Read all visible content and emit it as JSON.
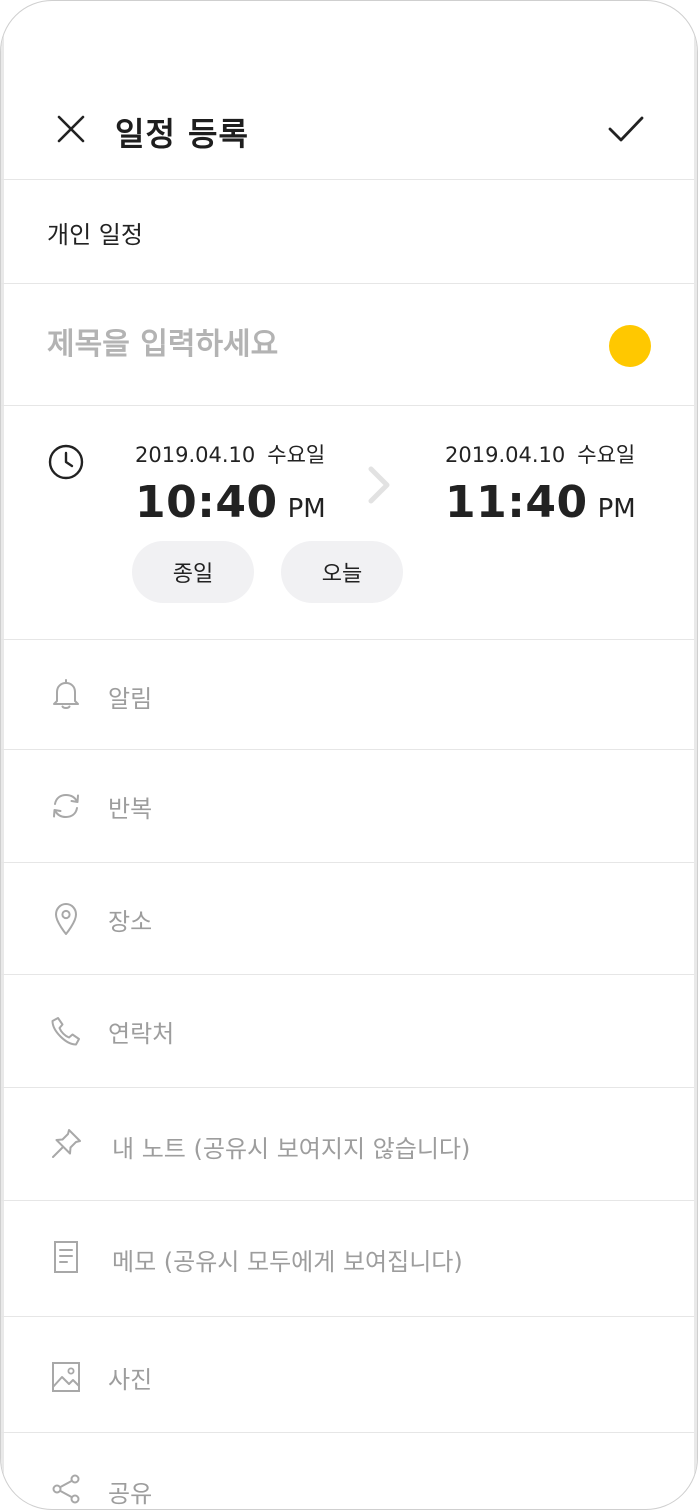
{
  "header": {
    "title": "일정 등록",
    "close_icon": "close-icon",
    "confirm_icon": "checkmark-icon"
  },
  "calendar": {
    "label": "개인 일정"
  },
  "event_title": {
    "placeholder": "제목을 입력하세요",
    "value": "",
    "color": "#FFC800"
  },
  "time": {
    "icon": "clock-icon",
    "start": {
      "date": "2019.04.10",
      "day_of_week": "수요일",
      "time": "10:40",
      "ampm": "PM"
    },
    "end": {
      "date": "2019.04.10",
      "day_of_week": "수요일",
      "time": "11:40",
      "ampm": "PM"
    },
    "arrow_icon": "chevron-right-icon",
    "all_day_label": "종일",
    "today_label": "오늘"
  },
  "options": [
    {
      "icon": "bell-icon",
      "label": "알림"
    },
    {
      "icon": "repeat-icon",
      "label": "반복"
    },
    {
      "icon": "location-pin-icon",
      "label": "장소"
    },
    {
      "icon": "phone-icon",
      "label": "연락처"
    },
    {
      "icon": "pin-icon",
      "label": "내 노트 (공유시 보여지지 않습니다)"
    },
    {
      "icon": "memo-icon",
      "label": "메모 (공유시 모두에게 보여집니다)"
    },
    {
      "icon": "photo-icon",
      "label": "사진"
    },
    {
      "icon": "share-icon",
      "label": "공유"
    }
  ],
  "colors": {
    "accent": "#FFC800",
    "text_primary": "#222222",
    "text_muted": "#9D9D9D",
    "divider": "#E6E6E6",
    "pill_bg": "#F1F1F3"
  }
}
